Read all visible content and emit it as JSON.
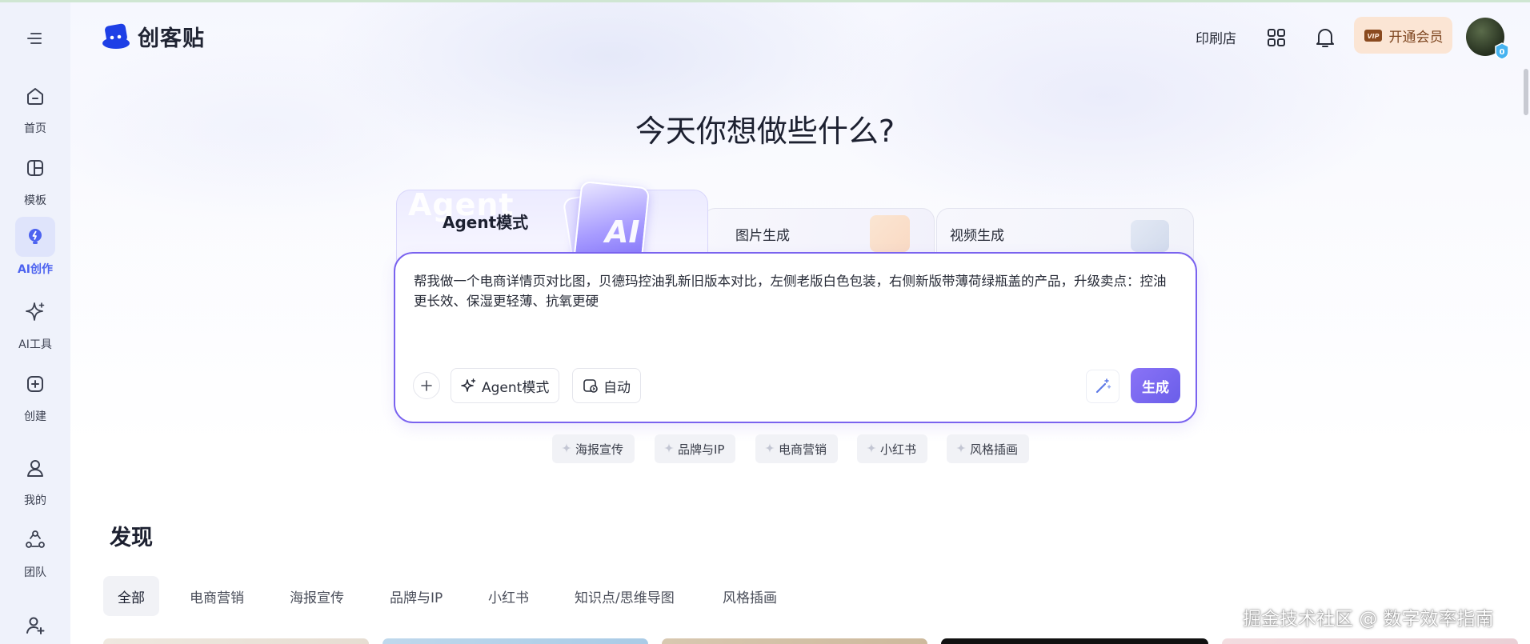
{
  "brand": {
    "name": "创客贴",
    "accent": "#4d63f0",
    "logo_color": "#1e3fe6"
  },
  "sidebar": {
    "items": [
      {
        "label": "首页",
        "icon": "home-icon"
      },
      {
        "label": "模板",
        "icon": "template-icon"
      },
      {
        "label": "AI创作",
        "icon": "bulb-icon",
        "active": true
      },
      {
        "label": "AI工具",
        "icon": "sparkle-icon"
      },
      {
        "label": "创建",
        "icon": "plus-square-icon"
      },
      {
        "label": "我的",
        "icon": "user-icon"
      },
      {
        "label": "团队",
        "icon": "team-icon"
      },
      {
        "label": "",
        "icon": "add-user-icon"
      }
    ]
  },
  "topbar": {
    "print_label": "印刷店",
    "apps_icon": "grid-icon",
    "bell_icon": "bell-icon",
    "vip_label": "开通会员",
    "vip_color": "#fbe5d4"
  },
  "hero": {
    "title": "今天你想做些什么?"
  },
  "mode_tabs": {
    "agent": {
      "label": "Agent模式",
      "ghost": "Agent",
      "badge": "AI"
    },
    "image": {
      "label": "图片生成"
    },
    "video": {
      "label": "视频生成"
    }
  },
  "prompt": {
    "text": "帮我做一个电商详情页对比图，贝德玛控油乳新旧版本对比，左侧老版白色包装，右侧新版带薄荷绿瓶盖的产品，升级卖点：控油更长效、保湿更轻薄、抗氧更硬",
    "agent_mode_label": "Agent模式",
    "auto_label": "自动",
    "generate_label": "生成",
    "border_color": "#7a63ef"
  },
  "quick_chips": [
    "海报宣传",
    "品牌与IP",
    "电商营销",
    "小红书",
    "风格插画"
  ],
  "discover": {
    "title": "发现",
    "tabs": [
      "全部",
      "电商营销",
      "海报宣传",
      "品牌与IP",
      "小红书",
      "知识点/思维导图",
      "风格插画"
    ],
    "active_tab": "全部"
  },
  "watermark": "掘金技术社区 @ 数字效率指南"
}
